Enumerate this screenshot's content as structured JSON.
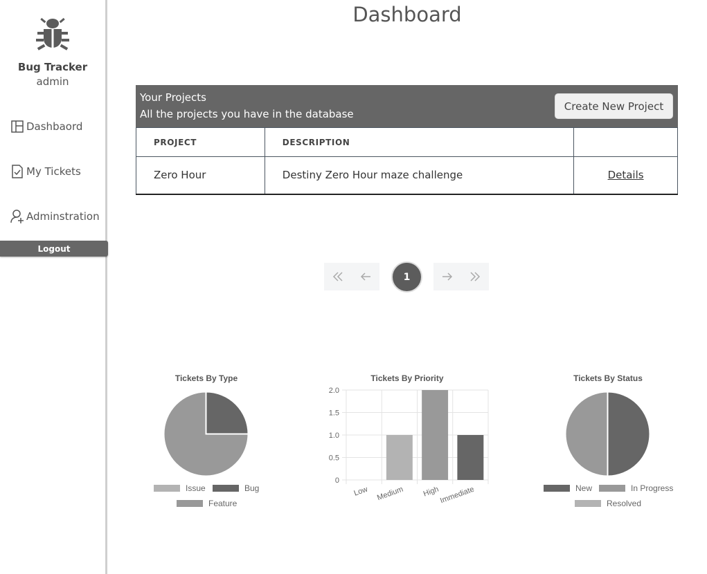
{
  "sidebar": {
    "app_name": "Bug Tracker",
    "user": "admin",
    "nav": [
      {
        "label": "Dashbaord",
        "icon": "layout-icon"
      },
      {
        "label": "My Tickets",
        "icon": "ticket-check-icon"
      },
      {
        "label": "Adminstration",
        "icon": "user-add-icon"
      }
    ],
    "logout_label": "Logout"
  },
  "page_title": "Dashboard",
  "projects": {
    "title": "Your Projects",
    "subtitle": "All the projects you have in the database",
    "create_button": "Create New Project",
    "columns": [
      "PROJECT",
      "DESCRIPTION",
      ""
    ],
    "rows": [
      {
        "project": "Zero Hour",
        "description": "Destiny Zero Hour maze challenge",
        "link": "Details"
      }
    ]
  },
  "pagination": {
    "current": "1"
  },
  "colors": {
    "dark": "#666666",
    "mid": "#999999",
    "light": "#b3b3b3",
    "header": "#666666"
  },
  "chart_data": [
    {
      "type": "pie",
      "title": "Tickets By Type",
      "labels": [
        "Issue",
        "Bug",
        "Feature"
      ],
      "values": [
        0,
        1,
        3
      ],
      "colors": [
        "#b3b3b3",
        "#666666",
        "#999999"
      ],
      "legend": "bottom"
    },
    {
      "type": "bar",
      "title": "Tickets By Priority",
      "categories": [
        "Low",
        "Medium",
        "High",
        "Immediate"
      ],
      "values": [
        0,
        1,
        2,
        1
      ],
      "colors": [
        "#cccccc",
        "#b3b3b3",
        "#999999",
        "#666666"
      ],
      "ylim": [
        0,
        2
      ],
      "yticks": [
        "0",
        "0.5",
        "1.0",
        "1.5",
        "2.0"
      ],
      "grid": true
    },
    {
      "type": "pie",
      "title": "Tickets By Status",
      "labels": [
        "New",
        "In Progress",
        "Resolved"
      ],
      "values": [
        1,
        1,
        0
      ],
      "colors": [
        "#666666",
        "#999999",
        "#b3b3b3"
      ],
      "legend": "bottom"
    }
  ]
}
